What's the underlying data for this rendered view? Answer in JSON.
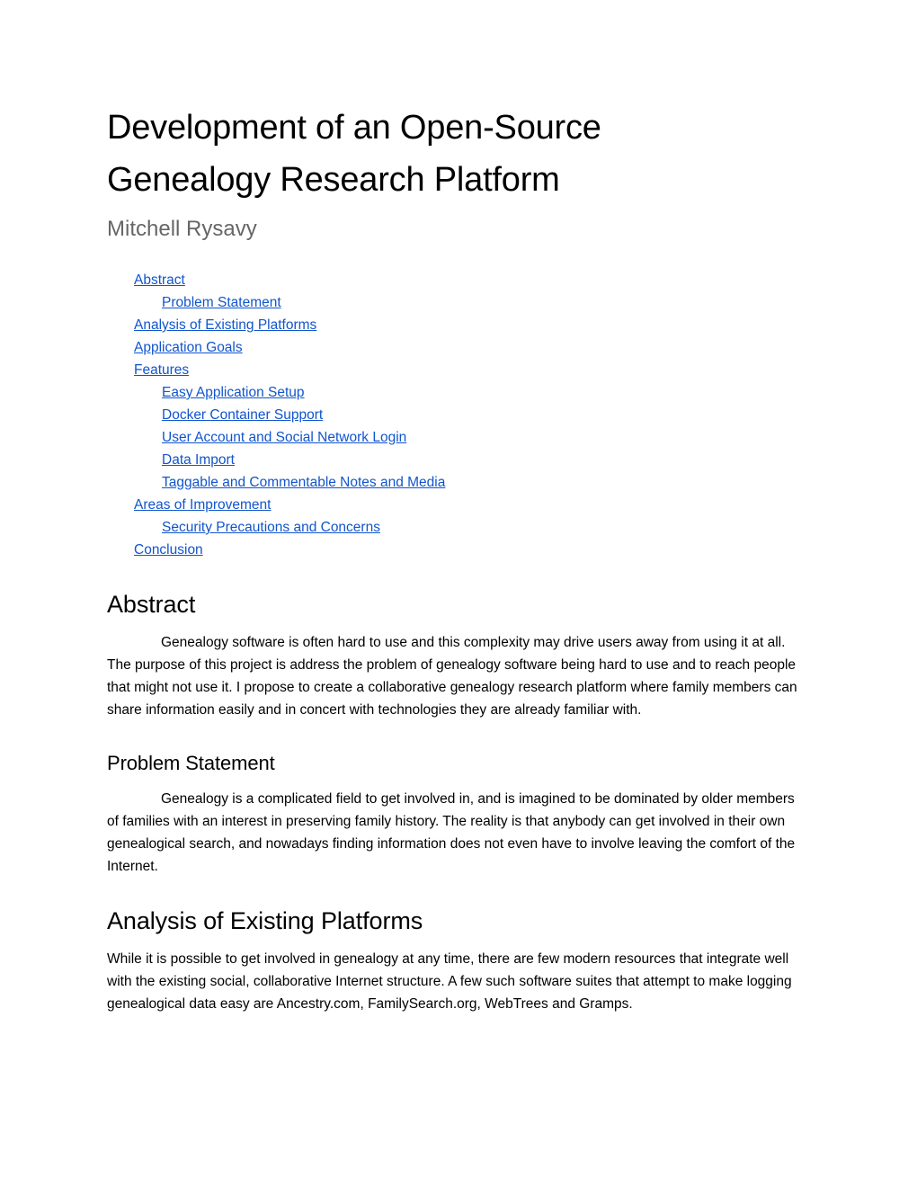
{
  "document": {
    "title": "Development of an Open-Source Genealogy Research Platform",
    "author": "Mitchell Rysavy",
    "link_color": "#1155cc",
    "author_color": "#666666",
    "background_color": "#ffffff"
  },
  "toc": {
    "items": [
      {
        "label": "Abstract",
        "level": 1
      },
      {
        "label": "Problem Statement",
        "level": 2
      },
      {
        "label": "Analysis of Existing Platforms",
        "level": 1
      },
      {
        "label": "Application Goals",
        "level": 1
      },
      {
        "label": "Features",
        "level": 1
      },
      {
        "label": "Easy Application Setup",
        "level": 2
      },
      {
        "label": "Docker Container Support",
        "level": 2
      },
      {
        "label": "User Account and Social Network Login",
        "level": 2
      },
      {
        "label": "Data Import",
        "level": 2
      },
      {
        "label": "Taggable and Commentable Notes and Media",
        "level": 2
      },
      {
        "label": "Areas of Improvement",
        "level": 1
      },
      {
        "label": "Security Precautions and Concerns",
        "level": 2
      },
      {
        "label": "Conclusion",
        "level": 1
      }
    ]
  },
  "sections": {
    "abstract": {
      "heading": "Abstract",
      "paragraph": "Genealogy software is often hard to use and this complexity may drive users away from using it at all. The purpose of this project is address the problem of genealogy software being hard to use and to reach people that might not use it. I propose to create a collaborative genealogy research platform where family members can share information easily and in concert with technologies they are already familiar with."
    },
    "problem_statement": {
      "heading": "Problem Statement",
      "paragraph": "Genealogy is a complicated field to get involved in, and is imagined to be dominated by older members of families with an interest in preserving family history. The reality is that anybody can get involved in their own genealogical search, and nowadays finding information does not even have to involve leaving the comfort of the Internet."
    },
    "analysis": {
      "heading": "Analysis of Existing Platforms",
      "paragraph": "While it is possible to get involved in genealogy at any time, there are few modern resources that integrate well with the existing social, collaborative Internet structure. A few such software suites that attempt to make logging genealogical data easy are Ancestry.com, FamilySearch.org, WebTrees and Gramps."
    }
  }
}
